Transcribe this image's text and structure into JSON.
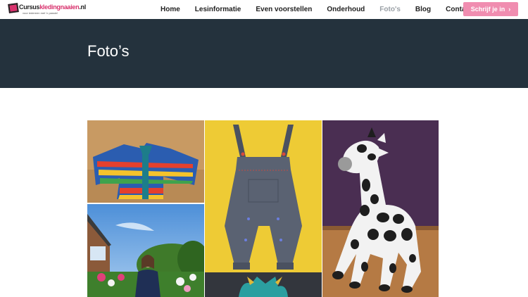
{
  "brand": {
    "name_main": "Cursus",
    "name_mid": "kledingnaaien",
    "name_tld": ".nl",
    "tagline": "voor iedereen met 'n passie!"
  },
  "nav": [
    {
      "label": "Home",
      "active": false
    },
    {
      "label": "Lesinformatie",
      "active": false
    },
    {
      "label": "Even voorstellen",
      "active": false
    },
    {
      "label": "Onderhoud",
      "active": false
    },
    {
      "label": "Foto's",
      "active": true
    },
    {
      "label": "Blog",
      "active": false
    },
    {
      "label": "Contact",
      "active": false
    }
  ],
  "cta": {
    "label": "Schrijf je in",
    "icon": "chevron-right-icon",
    "color": "#f08db0"
  },
  "hero": {
    "title": "Foto’s",
    "background": "#24323d"
  },
  "gallery": {
    "photos": [
      {
        "subject": "rainbow-jacket-photo"
      },
      {
        "subject": "garden-portrait-photo"
      },
      {
        "subject": "denim-dungarees-photo"
      },
      {
        "subject": "plush-giraffe-photo"
      }
    ]
  }
}
